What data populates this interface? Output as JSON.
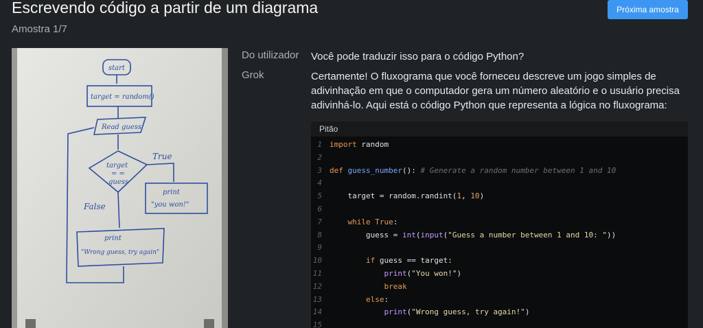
{
  "header": {
    "title": "Escrevendo código a partir de um diagrama",
    "subtitle": "Amostra 1/7",
    "next_button": "Próxima amostra"
  },
  "whiteboard": {
    "start": "start",
    "target_assign": "target = random()",
    "read": "Read guess",
    "decision_top": "target",
    "decision_mid": "= =",
    "decision_bottom": "guess",
    "true_label": "True",
    "false_label": "False",
    "print_label": "print",
    "you_won": "\"you won!\"",
    "print_label2": "print",
    "wrong": "\"Wrong guess, try again\""
  },
  "conversation": {
    "user_label": "Do utilizador",
    "user_message": "Você pode traduzir isso para o código Python?",
    "grok_label": "Grok",
    "grok_message": "Certamente! O fluxograma que você forneceu descreve um jogo simples de adivinhação em que o computador gera um número aleatório e o usuário precisa adivinhá-lo. Aqui está o código Python que representa a lógica no fluxograma:"
  },
  "code_block": {
    "language": "Pitão",
    "lines": [
      {
        "n": "1",
        "text": "import random"
      },
      {
        "n": "2",
        "text": ""
      },
      {
        "n": "3",
        "text": "def guess_number(): # Generate a random number between 1 and 10"
      },
      {
        "n": "4",
        "text": ""
      },
      {
        "n": "5",
        "text": "    target = random.randint(1, 10)"
      },
      {
        "n": "6",
        "text": ""
      },
      {
        "n": "7",
        "text": "    while True:"
      },
      {
        "n": "8",
        "text": "        guess = int(input(\"Guess a number between 1 and 10: \"))"
      },
      {
        "n": "9",
        "text": ""
      },
      {
        "n": "10",
        "text": "        if guess == target:"
      },
      {
        "n": "11",
        "text": "            print(\"You won!\")"
      },
      {
        "n": "12",
        "text": "            break"
      },
      {
        "n": "13",
        "text": "        else:"
      },
      {
        "n": "14",
        "text": "            print(\"Wrong guess, try again!\")"
      },
      {
        "n": "15",
        "text": ""
      }
    ]
  }
}
